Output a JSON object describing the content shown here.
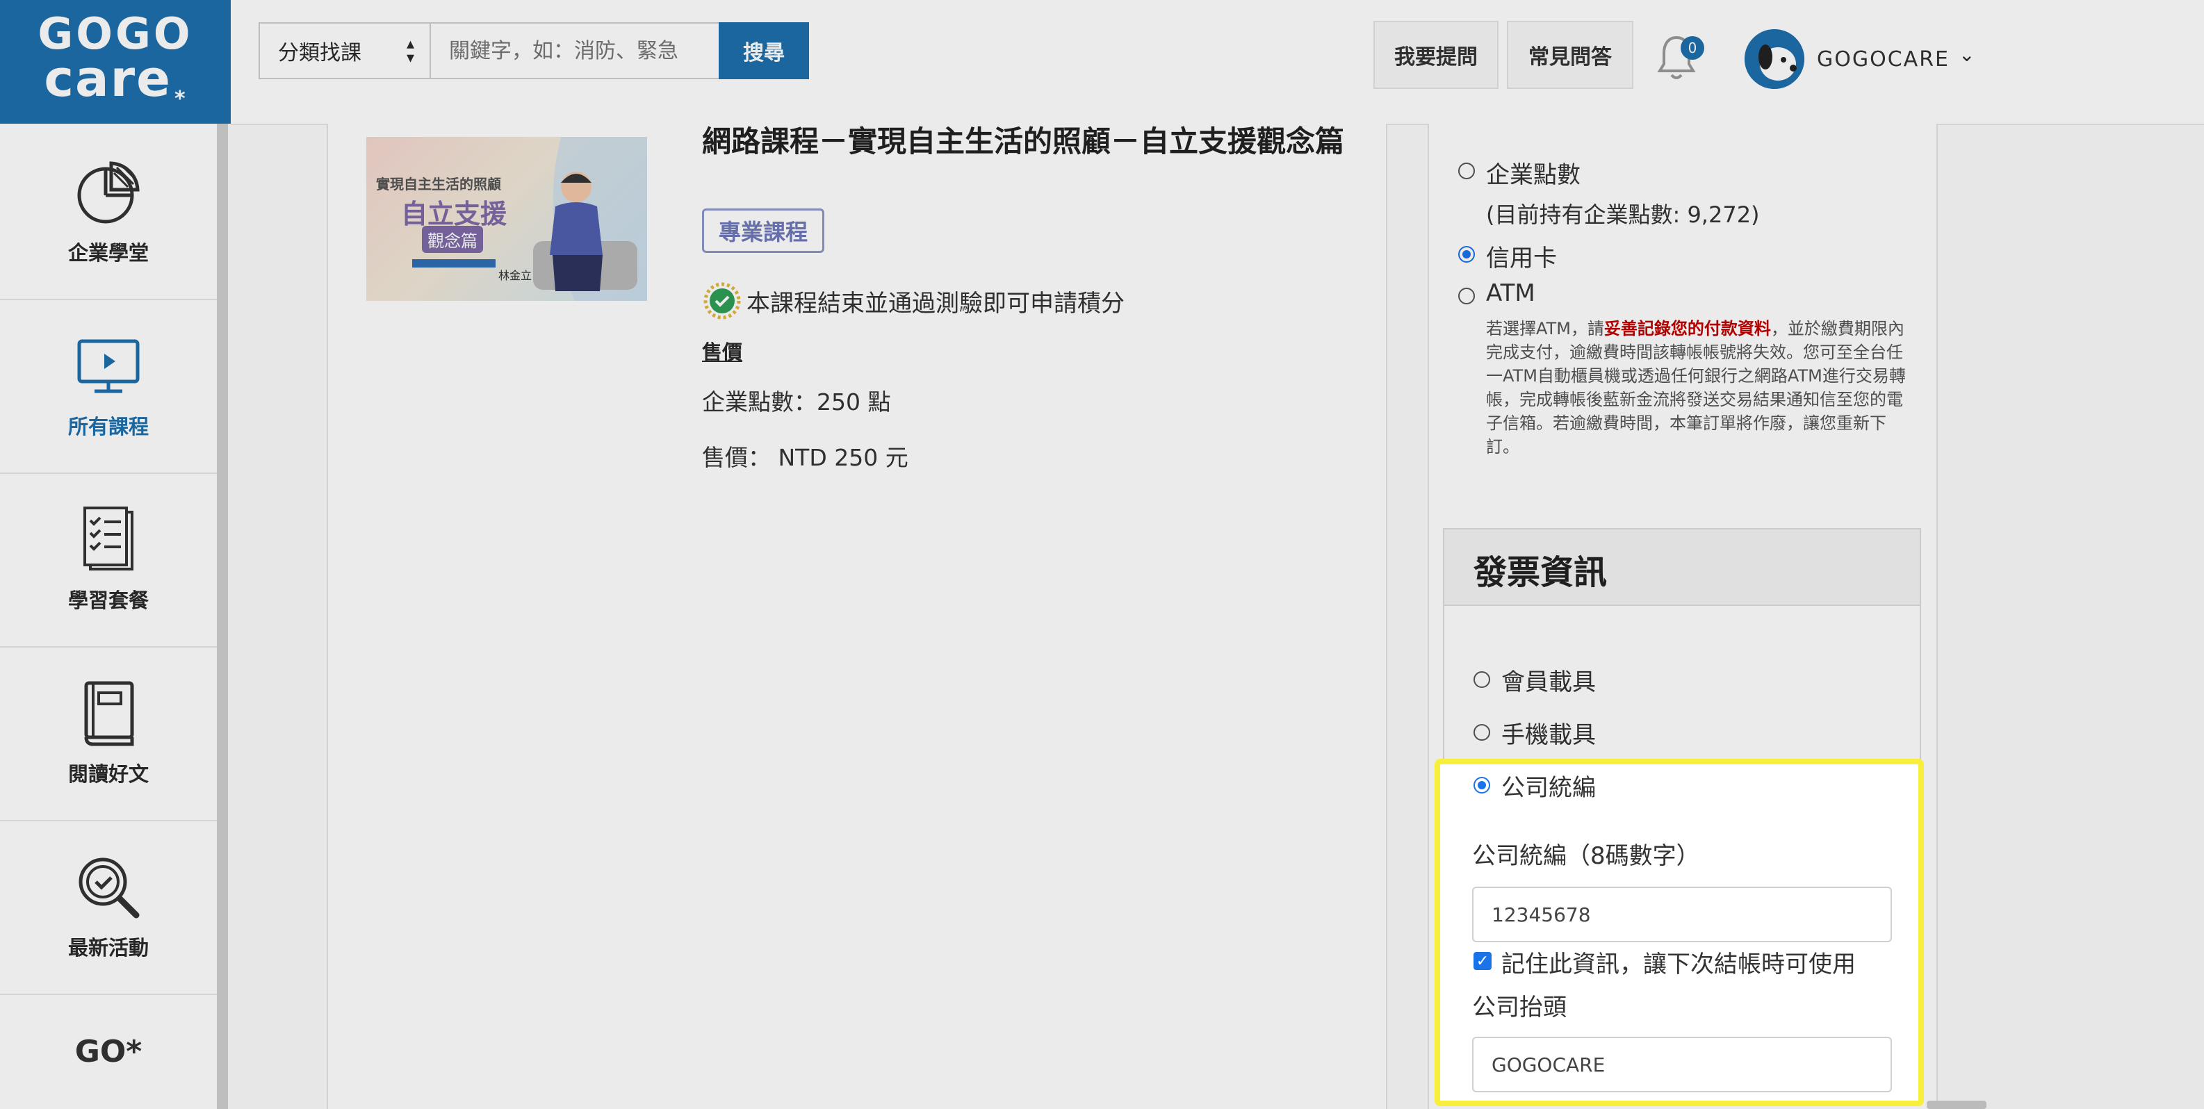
{
  "logo": {
    "line1": "GOGO",
    "line2": "care",
    "mark": "*"
  },
  "header": {
    "category_label": "分類找課",
    "search_placeholder": "關鍵字，如：消防、緊急",
    "search_button": "搜尋",
    "ask_button": "我要提問",
    "faq_button": "常見問答",
    "notifications_count": "0",
    "username": "GOGOCARE"
  },
  "sidebar": {
    "items": [
      {
        "label": "企業學堂",
        "icon": "pie-chart-icon"
      },
      {
        "label": "所有課程",
        "icon": "monitor-play-icon"
      },
      {
        "label": "學習套餐",
        "icon": "checklist-icon"
      },
      {
        "label": "閱讀好文",
        "icon": "book-icon"
      },
      {
        "label": "最新活動",
        "icon": "magnifier-check-icon"
      }
    ],
    "footer_logo": "GO*"
  },
  "course": {
    "title": "網路課程－實現自主生活的照顧－自立支援觀念篇",
    "badge": "專業課程",
    "credit_note": "本課程結束並通過測驗即可申請積分",
    "price_heading": "售價",
    "points": "企業點數：250 點",
    "price": "售價： NTD 250 元",
    "thumb_title": "實現自主生活的照顧",
    "thumb_main": "自立支援",
    "thumb_sub": "觀念篇",
    "thumb_person": "林金立"
  },
  "payment": {
    "options": [
      {
        "label": "企業點數",
        "selected": false
      },
      {
        "label": "信用卡",
        "selected": true
      },
      {
        "label": "ATM",
        "selected": false
      }
    ],
    "points_balance": "(目前持有企業點數: 9,272)",
    "atm_note_prefix": "若選擇ATM，請",
    "atm_note_highlight": "妥善記錄您的付款資料",
    "atm_note_rest": "，並於繳費期限內完成支付，逾繳費時間該轉帳帳號將失效。您可至全台任一ATM自動櫃員機或透過任何銀行之網路ATM進行交易轉帳，完成轉帳後藍新金流將發送交易結果通知信至您的電子信箱。若逾繳費時間，本筆訂單將作廢，讓您重新下訂。"
  },
  "invoice": {
    "title": "發票資訊",
    "options": [
      {
        "label": "會員載具",
        "selected": false
      },
      {
        "label": "手機載具",
        "selected": false
      },
      {
        "label": "公司統編",
        "selected": true
      }
    ],
    "tax_id_label": "公司統編（8碼數字）",
    "tax_id_value": "12345678",
    "remember_label": "記住此資訊，讓下次結帳時可使用",
    "remember_checked": true,
    "company_title_label": "公司抬頭",
    "company_title_value": "GOGOCARE"
  },
  "colors": {
    "brand": "#1f6fae",
    "highlight": "#f7ef3c",
    "warning": "#c00000"
  }
}
